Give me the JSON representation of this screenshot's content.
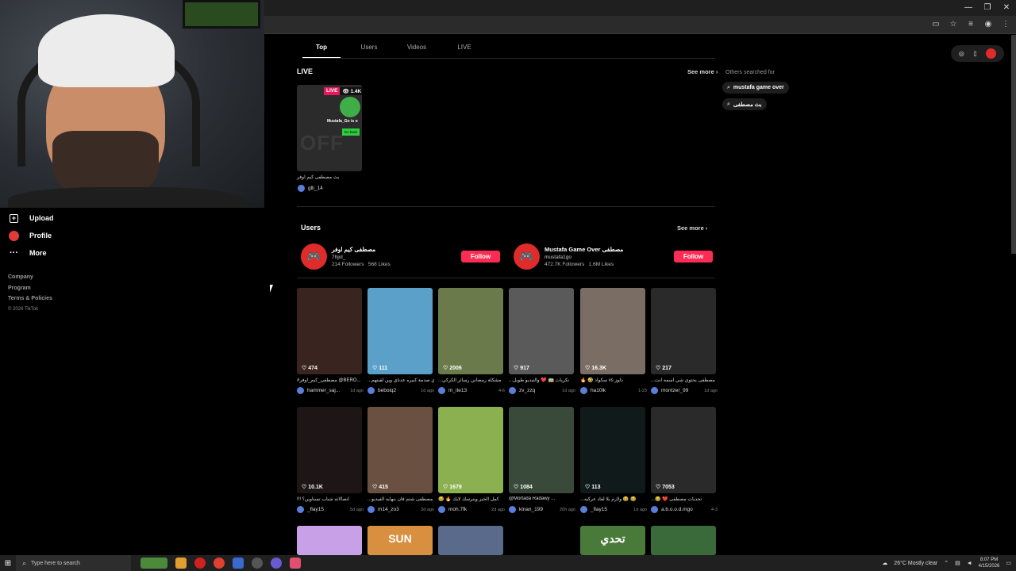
{
  "window": {
    "controls": [
      "—",
      "❐",
      "✕"
    ]
  },
  "browser": {
    "addr_icons": [
      "screen-icon",
      "star-icon",
      "menu-icon",
      "profile-icon",
      "kebab-icon"
    ]
  },
  "sidebar": {
    "items": [
      {
        "label": "Upload",
        "icon": "plus-square-icon"
      },
      {
        "label": "Profile",
        "icon": "profile-icon"
      },
      {
        "label": "More",
        "icon": "more-icon"
      }
    ],
    "links": [
      "Company",
      "Program",
      "Terms & Policies"
    ],
    "copyright": "© 2026 TikTok"
  },
  "tabs": [
    "Top",
    "Users",
    "Videos",
    "LIVE"
  ],
  "live_section": {
    "title": "LIVE",
    "see_more": "See more",
    "card": {
      "badge": "LIVE",
      "viewers": "1.4K",
      "banner": "Mustafa_Go is o",
      "go_back": "Go back",
      "caption": "بث مصطفى كيم اوفر",
      "user": "glli_14"
    }
  },
  "users_section": {
    "title": "Users",
    "see_more": "See more",
    "users": [
      {
        "name": "مصطفى كيم اوفر",
        "handle": "7hjol_",
        "followers": "214 Followers",
        "likes": "568 Likes",
        "follow": "Follow"
      },
      {
        "name": "Mustafa Game Over مصطفى",
        "handle": "mustafa1go",
        "followers": "472.7K Followers",
        "likes": "1.6M Likes",
        "follow": "Follow"
      }
    ]
  },
  "videos_row1": [
    {
      "likes": "474",
      "caption": "#مصطفى_كيم_اوفر @BERO...",
      "user": "hammer_saj...",
      "date": "1d ago",
      "color": "#3a2420"
    },
    {
      "likes": "111",
      "caption": "...ي صدمة كبيره عدناي وين لقيتهم",
      "user": "beboiq2",
      "date": "1d ago",
      "color": "#5aa0c8"
    },
    {
      "likes": "2006",
      "caption": "...مشكلة رمضاني رسائر الكركي",
      "user": "m_ite13",
      "date": "4-6",
      "color": "#6a7a4a"
    },
    {
      "likes": "917",
      "caption": "...نكريات 🚋 ❤️ والتيديو طويل",
      "user": "zv_zzq",
      "date": "1d ago",
      "color": "#5a5a5a"
    },
    {
      "likes": "16.3K",
      "caption": "🔥 🤣 سكواد vs دلوز",
      "user": "ha10lk",
      "date": "1-23",
      "color": "#7a6e64"
    },
    {
      "likes": "217",
      "caption": "...مصطفى يحتوي شي اسمه انت",
      "user": "montzer_99",
      "date": "1d ago",
      "color": "#2a2a2a"
    }
  ],
  "videos_row2": [
    {
      "likes": "10.1K",
      "caption": "!!! اتصالاته شباب تسناوين؟",
      "user": "_flay15",
      "date": "5d ago",
      "color": "#1e1616"
    },
    {
      "likes": "415",
      "caption": "...ينم مصطفى شتم فان بنهايه الفيديو",
      "user": "m14_zo3",
      "date": "3d ago",
      "color": "#6a5040"
    },
    {
      "likes": "1679",
      "caption": "😂 🔥 كمل الخير وينرسك لايك",
      "user": "moh.7fk",
      "date": "2d ago",
      "color": "#8ab050"
    },
    {
      "likes": "1084",
      "caption": "@Mortada Radawy ...",
      "user": "kinan_199",
      "date": "20h ago",
      "color": "#3a4a3a"
    },
    {
      "likes": "113",
      "caption": "...ولازم يلا لغاد عركيه 😂 😂",
      "user": "_flay15",
      "date": "1d ago",
      "color": "#101a1a"
    },
    {
      "likes": "7053",
      "caption": "...😂 ❤️ تحديات مصطفى",
      "user": "a.b.o.o.d.mgo",
      "date": "4-3",
      "color": "#2a2a2a"
    }
  ],
  "videos_row3": [
    {
      "color": "#c8a0e8"
    },
    {
      "color": "#d89040",
      "text": "SUN"
    },
    {
      "color": "#5a6a8a"
    },
    {
      "color": "#000000"
    },
    {
      "color": "#4a7a3a",
      "text": "تحدي"
    },
    {
      "color": "#3a6a3a"
    }
  ],
  "right_panel": {
    "others_title": "Others searched for",
    "chips": [
      "mustafa game over",
      "بث مصطفى"
    ]
  },
  "taskbar": {
    "search_placeholder": "Type here to search",
    "weather": "26°C  Mostly clear",
    "time": "8:07 PM",
    "date": "4/15/2026"
  },
  "colors": {
    "accent": "#fe2c55",
    "live": "#e5195e",
    "avatar_red": "#e02b2b"
  }
}
